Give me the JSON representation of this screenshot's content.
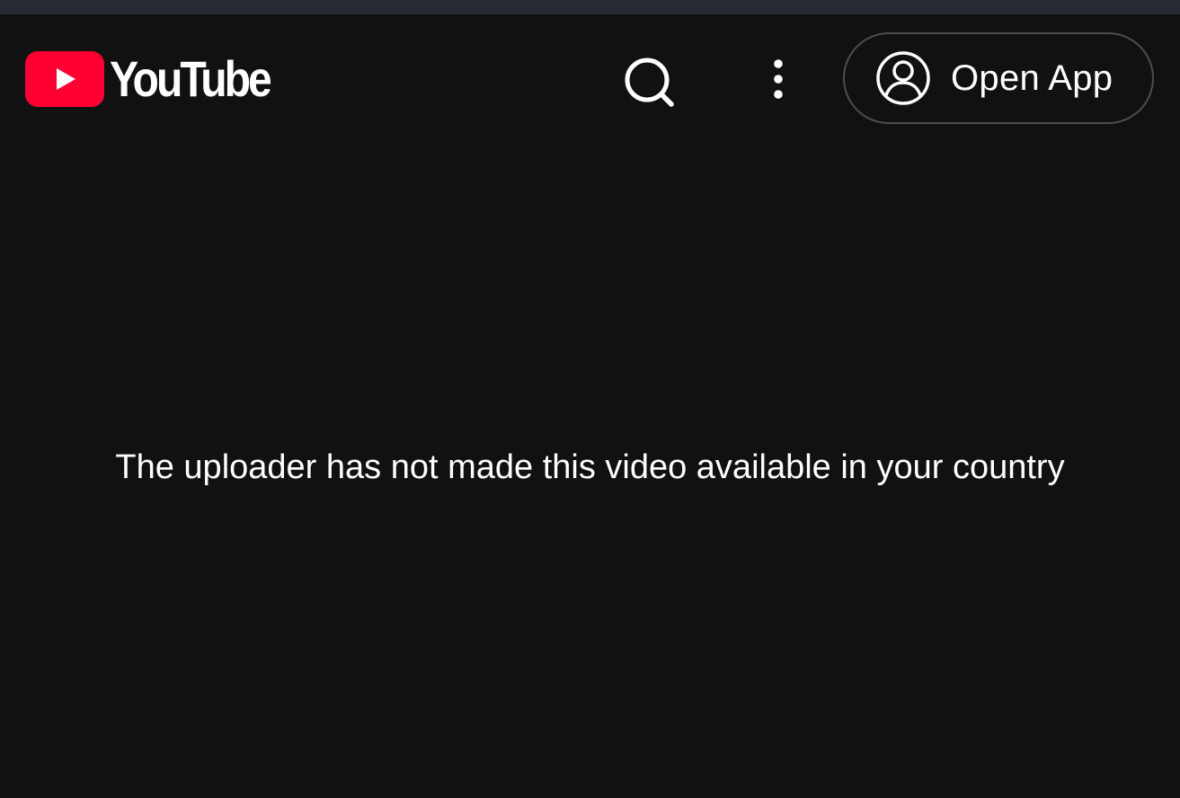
{
  "header": {
    "logo_text": "YouTube",
    "logo_icon": "youtube-play-logo",
    "search_icon": "search-icon",
    "more_icon": "more-vert-icon",
    "open_app_label": "Open App",
    "open_app_icon": "account-circle-icon"
  },
  "main": {
    "message": "The uploader has not made this video available in your country"
  },
  "colors": {
    "background": "#121112",
    "brand_red": "#ff0033",
    "text": "#ffffff",
    "button_border": "#4d4c4e",
    "status_strip": "#252a33"
  }
}
